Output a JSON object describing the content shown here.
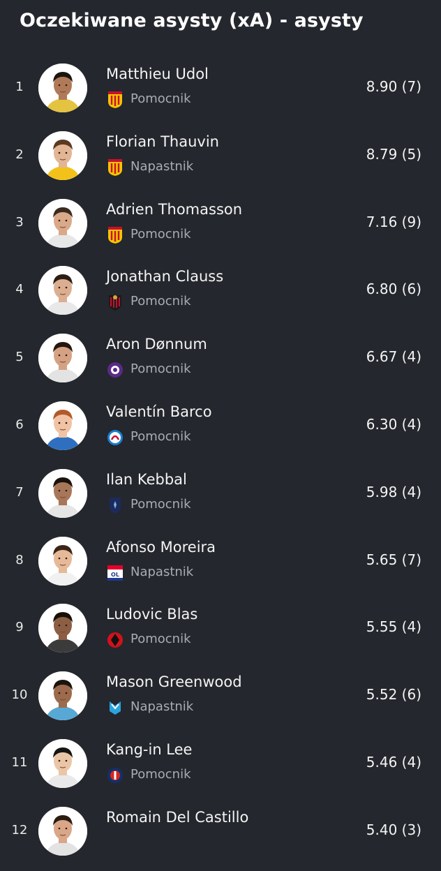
{
  "page": {
    "title": "Oczekiwane asysty (xA) - asysty"
  },
  "players": [
    {
      "rank": "1",
      "name": "Matthieu Udol",
      "position": "Pomocnik",
      "value": "8.90 (7)",
      "club_icon": "rc-lens-crest-icon",
      "skin": "#b07a58",
      "hair": "#1c140f",
      "shirt": "#e4c341"
    },
    {
      "rank": "2",
      "name": "Florian Thauvin",
      "position": "Napastnik",
      "value": "8.79 (5)",
      "club_icon": "rc-lens-crest-icon",
      "skin": "#e2b594",
      "hair": "#5a3a22",
      "shirt": "#f2c21b"
    },
    {
      "rank": "3",
      "name": "Adrien Thomasson",
      "position": "Pomocnik",
      "value": "7.16 (9)",
      "club_icon": "rc-lens-crest-icon",
      "skin": "#d9a98a",
      "hair": "#3b2a1e",
      "shirt": "#e7e7e7"
    },
    {
      "rank": "4",
      "name": "Jonathan Clauss",
      "position": "Pomocnik",
      "value": "6.80 (6)",
      "club_icon": "ogc-nice-crest-icon",
      "skin": "#dcae90",
      "hair": "#2b1d15",
      "shirt": "#e8e8e8"
    },
    {
      "rank": "5",
      "name": "Aron Dønnum",
      "position": "Pomocnik",
      "value": "6.67 (4)",
      "club_icon": "toulouse-crest-icon",
      "skin": "#d4a283",
      "hair": "#24170f",
      "shirt": "#e3e3e3"
    },
    {
      "rank": "6",
      "name": "Valentín Barco",
      "position": "Pomocnik",
      "value": "6.30 (4)",
      "club_icon": "strasbourg-crest-icon",
      "skin": "#f0c3a5",
      "hair": "#b25a2b",
      "shirt": "#2f6fbf"
    },
    {
      "rank": "7",
      "name": "Ilan Kebbal",
      "position": "Pomocnik",
      "value": "5.98 (4)",
      "club_icon": "paris-fc-crest-icon",
      "skin": "#a8775a",
      "hair": "#1a120c",
      "shirt": "#e6e6e6"
    },
    {
      "rank": "8",
      "name": "Afonso Moreira",
      "position": "Napastnik",
      "value": "5.65 (7)",
      "club_icon": "olympique-lyonnais-crest-icon",
      "skin": "#e6b998",
      "hair": "#3a2618",
      "shirt": "#f1f1f1"
    },
    {
      "rank": "9",
      "name": "Ludovic Blas",
      "position": "Pomocnik",
      "value": "5.55 (4)",
      "club_icon": "stade-rennais-crest-icon",
      "skin": "#8c5e44",
      "hair": "#171008",
      "shirt": "#3b3b3b"
    },
    {
      "rank": "10",
      "name": "Mason Greenwood",
      "position": "Napastnik",
      "value": "5.52 (6)",
      "club_icon": "olympique-marseille-crest-icon",
      "skin": "#9c6a4d",
      "hair": "#1b130d",
      "shirt": "#58a8d6"
    },
    {
      "rank": "11",
      "name": "Kang-in Lee",
      "position": "Pomocnik",
      "value": "5.46 (4)",
      "club_icon": "psg-crest-icon",
      "skin": "#ebc6a6",
      "hair": "#151515",
      "shirt": "#e9e9e9"
    },
    {
      "rank": "12",
      "name": "Romain Del Castillo",
      "position": "",
      "value": "5.40 (3)",
      "club_icon": "",
      "skin": "#d9a688",
      "hair": "#2b1c12",
      "shirt": "#e3e3e3"
    }
  ]
}
